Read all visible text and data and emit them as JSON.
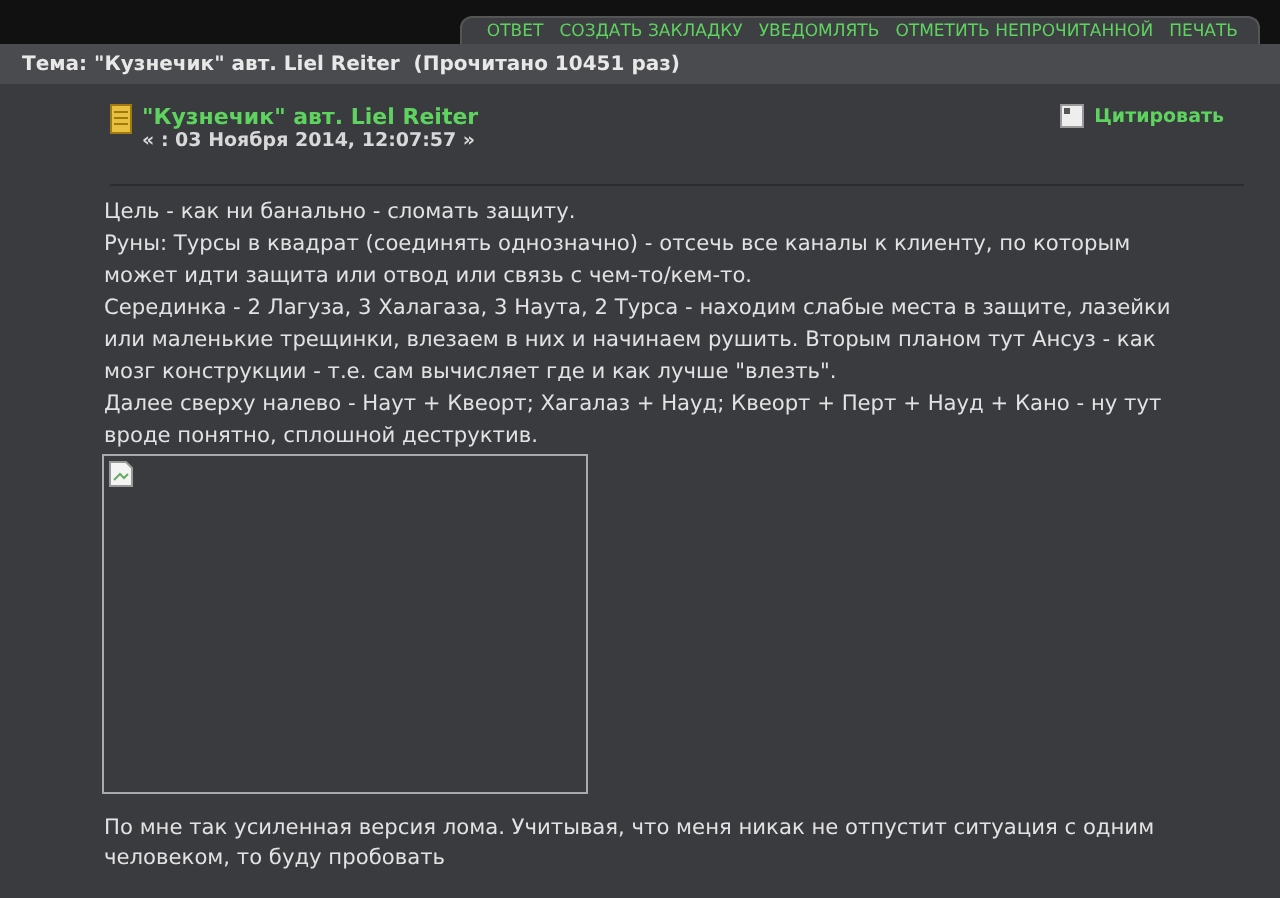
{
  "actions": [
    "ОТВЕТ",
    "СОЗДАТЬ ЗАКЛАДКУ",
    "УВЕДОМЛЯТЬ",
    "ОТМЕТИТЬ НЕПРОЧИТАННОЙ",
    "ПЕЧАТЬ"
  ],
  "topic_title": "Тема: \"Кузнечик\" авт. Liel Reiter  (Прочитано 10451 раз)",
  "post": {
    "title": "\"Кузнечик\" авт. Liel Reiter",
    "date": "« : 03 Ноября 2014, 12:07:57 »",
    "quote": "Цитировать",
    "paragraphs": [
      "Цель - как ни банально - сломать защиту.",
      "Руны: Турсы в квадрат (соединять однозначно) - отсечь все каналы к клиенту, по которым может идти защита или отвод или связь с чем-то/кем-то.",
      "Серединка - 2 Лагуза, 3 Халагаза, 3 Наута, 2 Турса - находим слабые места в защите, лазейки или маленькие трещинки, влезаем в них и начинаем рушить. Вторым планом тут Ансуз - как мозг конструкции - т.е. сам вычисляет где и как лучше \"влезть\".",
      "Далее сверху налево - Наут + Квеорт; Хагалаз + Науд; Квеорт + Перт + Науд + Кано - ну тут вроде понятно, сплошной деструктив."
    ],
    "after": "По мне так усиленная версия лома. Учитывая, что меня никак не отпустит ситуация с одним человеком, то буду пробовать"
  }
}
